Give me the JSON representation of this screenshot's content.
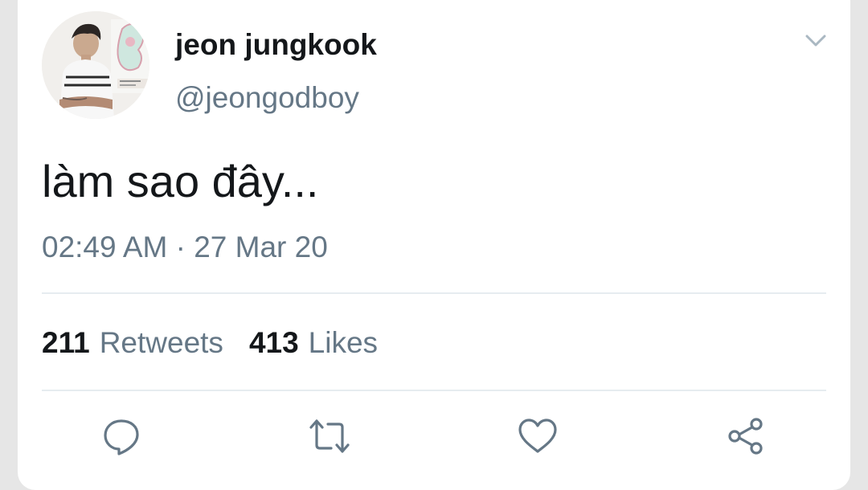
{
  "user": {
    "display_name": "jeon jungkook",
    "handle": "@jeongodboy",
    "avatar_icon": "profile-photo"
  },
  "tweet": {
    "text": "làm sao đây...",
    "timestamp": "02:49 AM · 27 Mar 20"
  },
  "stats": {
    "retweets_count": "211",
    "retweets_label": "Retweets",
    "likes_count": "413",
    "likes_label": "Likes"
  },
  "actions": [
    {
      "name": "reply",
      "icon": "speech-bubble-icon"
    },
    {
      "name": "retweet",
      "icon": "retweet-arrows-icon"
    },
    {
      "name": "like",
      "icon": "heart-icon"
    },
    {
      "name": "share",
      "icon": "share-icon"
    }
  ],
  "menu": {
    "icon": "chevron-down-icon"
  },
  "colors": {
    "text_primary": "#14171a",
    "text_secondary": "#657786",
    "icon_gray": "#657786",
    "chevron": "#aab8c2",
    "divider": "#e6ecf0",
    "card_background": "#ffffff",
    "page_background": "#e6e6e6"
  }
}
